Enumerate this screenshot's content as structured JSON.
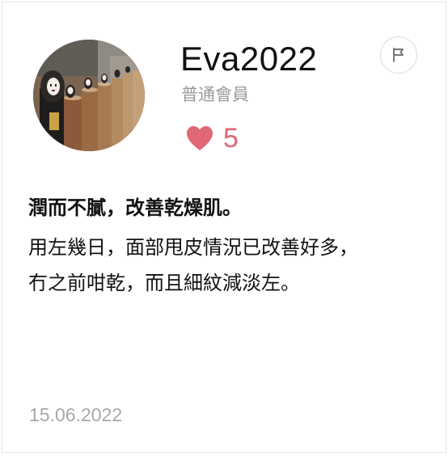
{
  "review": {
    "username": "Eva2022",
    "member_level": "普通會員",
    "like_count": "5",
    "title": "潤而不膩，改善乾燥肌。",
    "body_lines": [
      "用左幾日，面部甩皮情況已改善好多，",
      "冇之前咁乾，而且細紋減淡左。"
    ],
    "date": "15.06.2022"
  },
  "icons": {
    "like": "heart-icon",
    "report": "flag-icon"
  },
  "colors": {
    "accent": "#e06775",
    "muted_text": "#9a9a9a",
    "text": "#111111"
  }
}
